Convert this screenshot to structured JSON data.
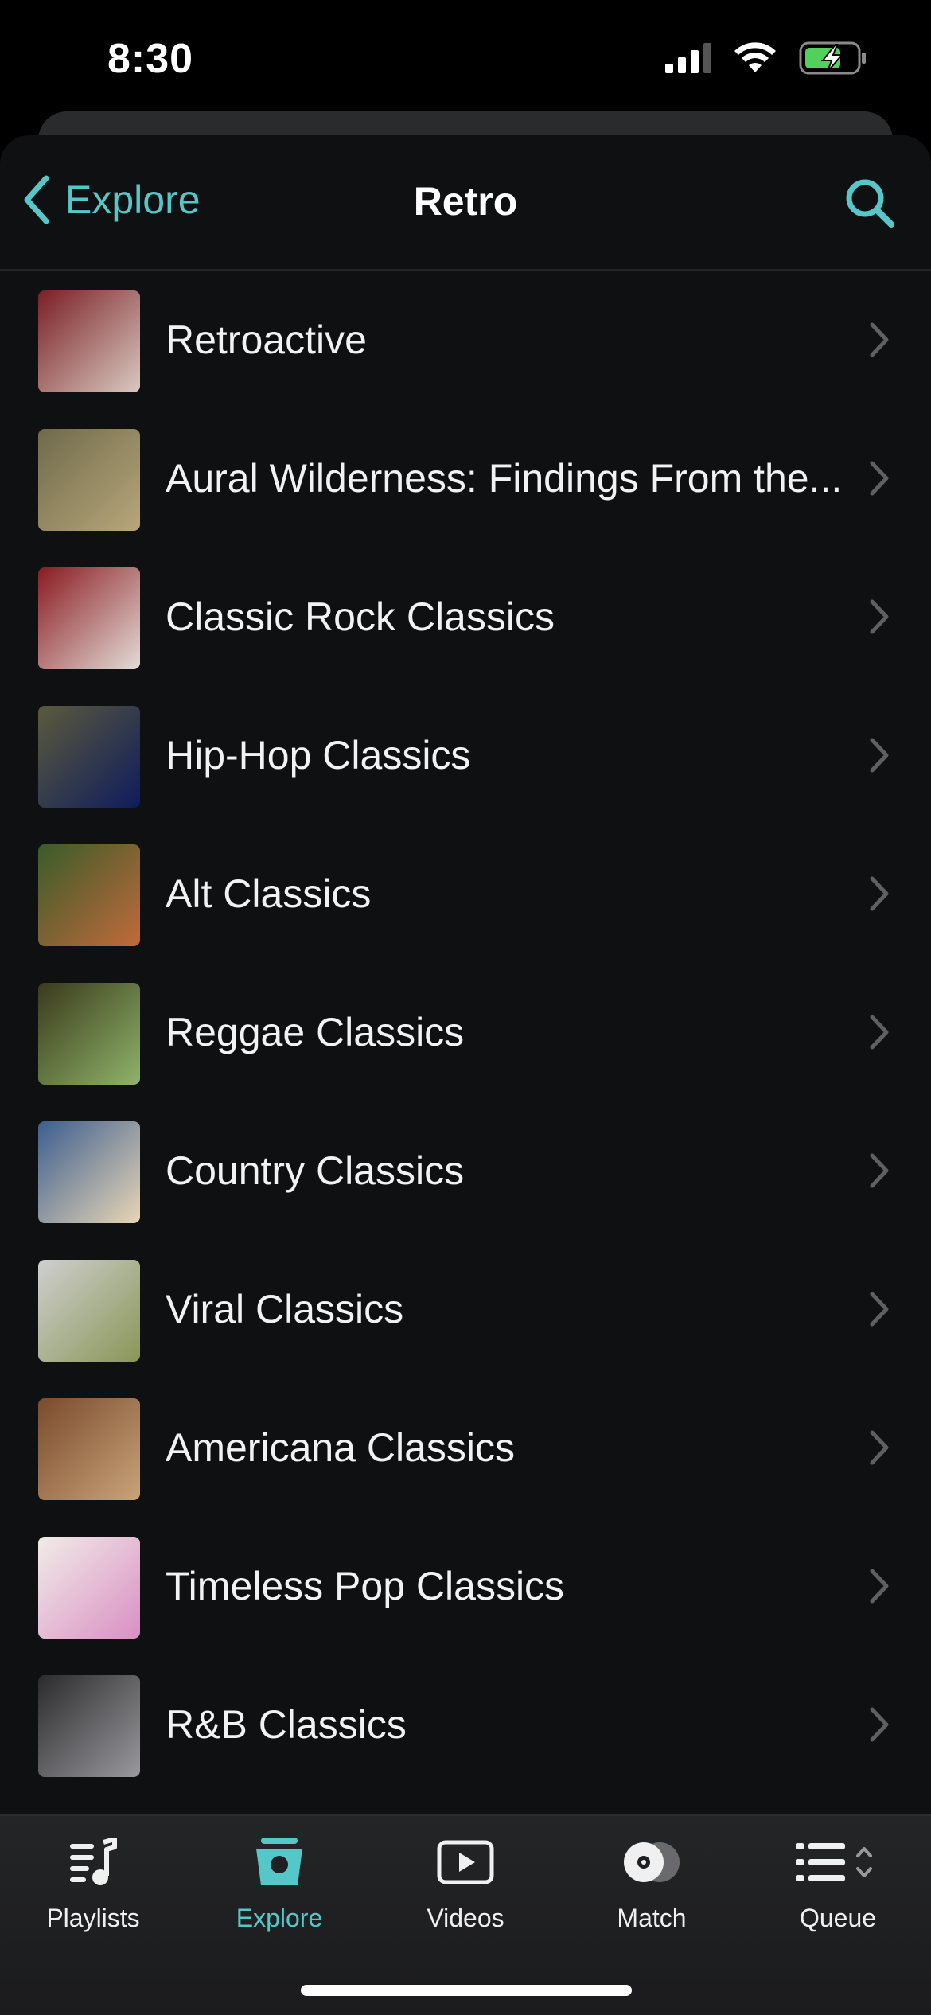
{
  "status_bar": {
    "time": "8:30"
  },
  "nav": {
    "back_label": "Explore",
    "title": "Retro"
  },
  "colors": {
    "accent": "#56c7c8",
    "background": "#0f1011",
    "tabbar": "#1f2022"
  },
  "playlists": [
    {
      "title": "Retroactive",
      "thumb": [
        "#7a1f25",
        "#d9c9c0"
      ]
    },
    {
      "title": "Aural Wilderness: Findings From the...",
      "thumb": [
        "#6f6a4b",
        "#b8a77a"
      ]
    },
    {
      "title": "Classic Rock Classics",
      "thumb": [
        "#8a1b22",
        "#e3dcd6"
      ]
    },
    {
      "title": "Hip-Hop Classics",
      "thumb": [
        "#5b5a3c",
        "#0e1c5c"
      ]
    },
    {
      "title": "Alt Classics",
      "thumb": [
        "#3a5b2a",
        "#c26a3b"
      ]
    },
    {
      "title": "Reggae Classics",
      "thumb": [
        "#3b3a1c",
        "#8fb36a"
      ]
    },
    {
      "title": "Country Classics",
      "thumb": [
        "#3c5e90",
        "#e8d6b5"
      ]
    },
    {
      "title": "Viral Classics",
      "thumb": [
        "#cfcfcf",
        "#8a9657"
      ]
    },
    {
      "title": "Americana Classics",
      "thumb": [
        "#7a4b2c",
        "#c9a37a"
      ]
    },
    {
      "title": "Timeless Pop Classics",
      "thumb": [
        "#f1ece8",
        "#d98fc3"
      ]
    },
    {
      "title": "R&B Classics",
      "thumb": [
        "#2b2b2e",
        "#9a9a9e"
      ]
    }
  ],
  "tabs": [
    {
      "label": "Playlists",
      "icon": "playlist-icon"
    },
    {
      "label": "Explore",
      "icon": "explore-icon",
      "active": true
    },
    {
      "label": "Videos",
      "icon": "video-icon"
    },
    {
      "label": "Match",
      "icon": "match-icon"
    },
    {
      "label": "Queue",
      "icon": "queue-icon"
    }
  ]
}
